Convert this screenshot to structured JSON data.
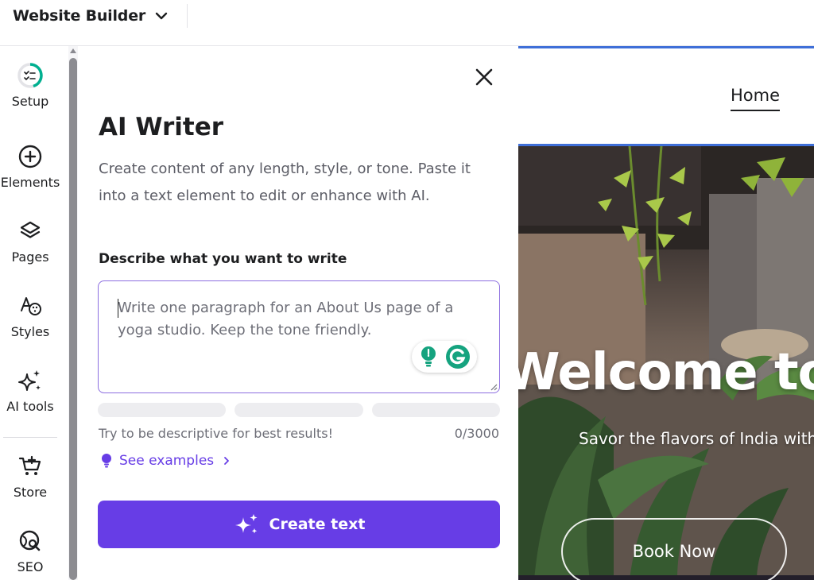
{
  "topbar": {
    "title": "Website Builder"
  },
  "sidebar": {
    "items": [
      {
        "label": "Setup",
        "icon": "setup-progress-icon"
      },
      {
        "label": "Elements",
        "icon": "plus-circle-icon"
      },
      {
        "label": "Pages",
        "icon": "layers-icon"
      },
      {
        "label": "Styles",
        "icon": "palette-icon"
      },
      {
        "label": "AI tools",
        "icon": "sparkles-icon"
      },
      {
        "label": "Store",
        "icon": "cart-icon"
      },
      {
        "label": "SEO",
        "icon": "seo-search-icon"
      }
    ]
  },
  "ai_writer": {
    "title": "AI Writer",
    "description": "Create content of any length, style, or tone. Paste it into a text element to edit or enhance with AI.",
    "field_label": "Describe what you want to write",
    "placeholder": "Write one paragraph for an About Us page of a yoga studio. Keep the tone friendly.",
    "hint": "Try to be descriptive for best results!",
    "counter": "0/3000",
    "examples_link": "See examples",
    "create_button": "Create text",
    "accent_color": "#673de6"
  },
  "preview": {
    "nav_item": "Home",
    "hero_title": "Welcome to S",
    "hero_subtitle": "Savor the flavors of India with",
    "hero_button": "Book Now"
  }
}
